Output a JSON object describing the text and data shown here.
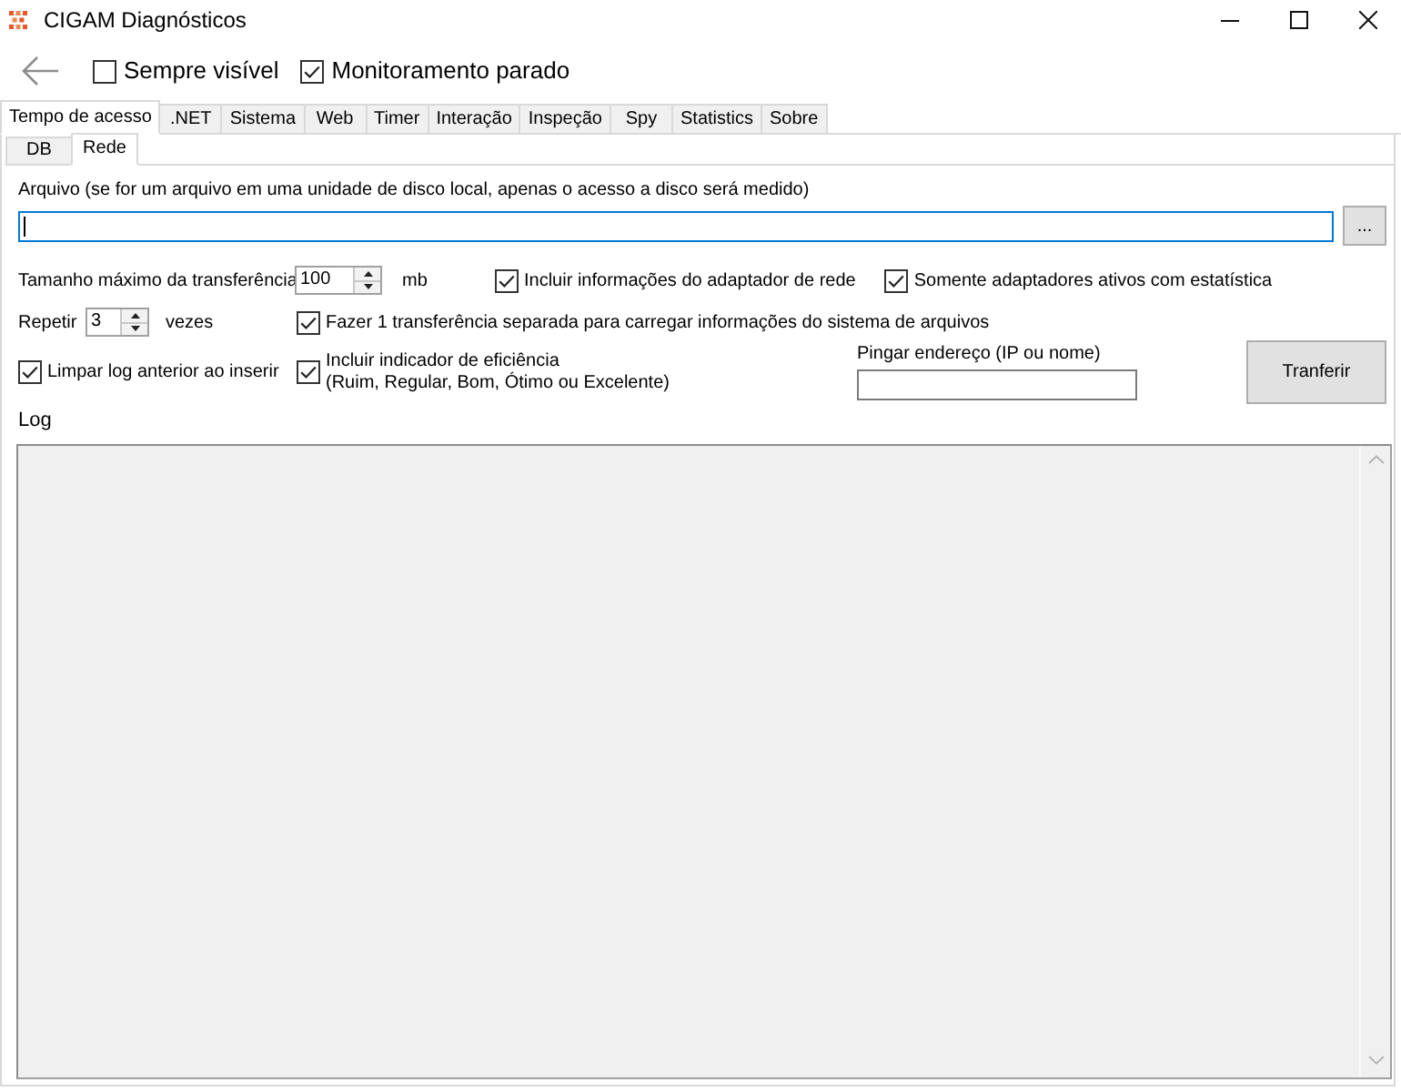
{
  "window": {
    "title": "CIGAM Diagnósticos"
  },
  "toolbar": {
    "options": [
      {
        "label": "Sempre visível",
        "checked": false
      },
      {
        "label": "Monitoramento parado",
        "checked": true
      }
    ]
  },
  "tabs": [
    {
      "label": "Tempo de acesso",
      "selected": true
    },
    {
      "label": ".NET",
      "selected": false
    },
    {
      "label": "Sistema",
      "selected": false
    },
    {
      "label": "Web",
      "selected": false
    },
    {
      "label": "Timer",
      "selected": false
    },
    {
      "label": "Interação",
      "selected": false
    },
    {
      "label": "Inspeção",
      "selected": false
    },
    {
      "label": "Spy",
      "selected": false
    },
    {
      "label": "Statistics",
      "selected": false
    },
    {
      "label": "Sobre",
      "selected": false
    }
  ],
  "subtabs": [
    {
      "label": "DB",
      "selected": false
    },
    {
      "label": "Rede",
      "selected": true
    }
  ],
  "file": {
    "label": "Arquivo (se for um arquivo em uma unidade de disco local, apenas o acesso a disco será medido)",
    "focused": true,
    "browse_button": "..."
  },
  "transfer_size": {
    "label": "Tamanho máximo da transferência",
    "value": "100",
    "unit": "mb"
  },
  "adapter_info": {
    "label": "Incluir informações do adaptador de rede",
    "checked": true
  },
  "active_adapters_only": {
    "label": "Somente adaptadores ativos com estatística",
    "checked": true
  },
  "repeat": {
    "label": "Repetir",
    "value": "3",
    "unit": "vezes"
  },
  "separate_transfer": {
    "label": "Fazer 1 transferência separada para carregar informações do sistema de arquivos",
    "checked": true
  },
  "clear_log": {
    "label": "Limpar log anterior ao inserir",
    "checked": true
  },
  "efficiency_indicator": {
    "label": "Incluir indicador de eficiência\n(Ruim, Regular, Bom, Ótimo ou Excelente)",
    "checked": true
  },
  "ping": {
    "label": "Pingar endereço (IP ou nome)"
  },
  "transfer_button": {
    "label": "Tranferir"
  },
  "log": {
    "label": "Log"
  }
}
